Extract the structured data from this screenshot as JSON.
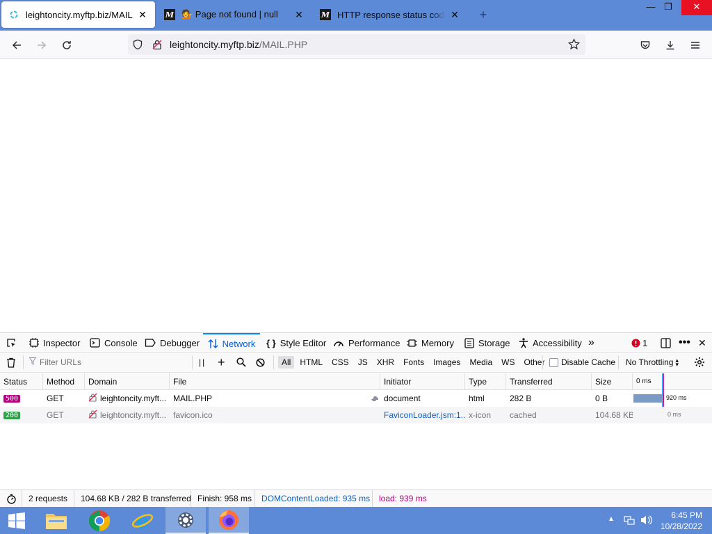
{
  "browser": {
    "tabs": [
      {
        "title": "leightoncity.myftp.biz/MAIL.PHP",
        "active": true
      },
      {
        "title": "💁 Page not found | null",
        "active": false
      },
      {
        "title": "HTTP response status codes - HTTP",
        "active": false
      }
    ],
    "url_host": "leightoncity.myftp.biz",
    "url_path": "/MAIL.PHP"
  },
  "devtools": {
    "tabs": [
      {
        "label": "Inspector",
        "icon": "inspector-icon"
      },
      {
        "label": "Console",
        "icon": "console-icon"
      },
      {
        "label": "Debugger",
        "icon": "debugger-icon"
      },
      {
        "label": "Network",
        "icon": "network-icon"
      },
      {
        "label": "Style Editor",
        "icon": "style-editor-icon"
      },
      {
        "label": "Performance",
        "icon": "performance-icon"
      },
      {
        "label": "Memory",
        "icon": "memory-icon"
      },
      {
        "label": "Storage",
        "icon": "storage-icon"
      },
      {
        "label": "Accessibility",
        "icon": "accessibility-icon"
      }
    ],
    "error_count": "1",
    "filter_placeholder": "Filter URLs",
    "type_filters": [
      "All",
      "HTML",
      "CSS",
      "JS",
      "XHR",
      "Fonts",
      "Images",
      "Media",
      "WS",
      "Other"
    ],
    "disable_cache_label": "Disable Cache",
    "throttling_label": "No Throttling",
    "columns": {
      "status": "Status",
      "method": "Method",
      "domain": "Domain",
      "file": "File",
      "initiator": "Initiator",
      "type": "Type",
      "transferred": "Transferred",
      "size": "Size",
      "waterfall": "0 ms"
    },
    "requests": [
      {
        "status": "500",
        "status_color": "#b5007f",
        "method": "GET",
        "domain": "leightoncity.myft...",
        "file": "MAIL.PHP",
        "initiator": "document",
        "type": "html",
        "transferred": "282 B",
        "size": "0 B",
        "timing": "920 ms"
      },
      {
        "status": "200",
        "status_color": "#30a04b",
        "method": "GET",
        "domain": "leightoncity.myft...",
        "file": "favicon.ico",
        "initiator": "FaviconLoader.jsm:1...",
        "type": "x-icon",
        "transferred": "cached",
        "size": "104.68 KB",
        "timing": "0 ms"
      }
    ],
    "summary": {
      "requests": "2 requests",
      "transferred": "104.68 KB / 282 B transferred",
      "finish": "Finish: 958 ms",
      "dom_content_loaded": "DOMContentLoaded: 935 ms",
      "load": "load: 939 ms"
    }
  },
  "taskbar": {
    "time": "6:45 PM",
    "date": "10/28/2022"
  }
}
